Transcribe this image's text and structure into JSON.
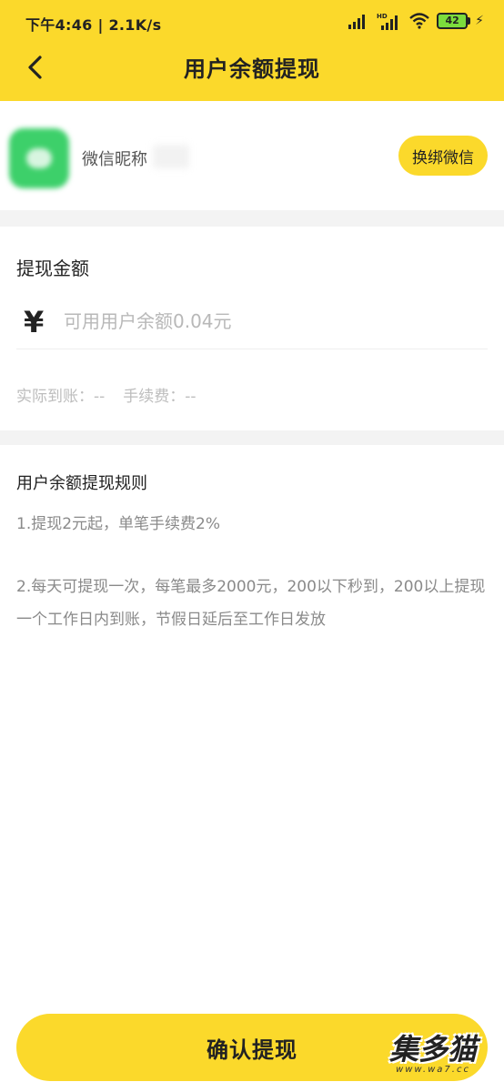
{
  "status_bar": {
    "time": "下午4:46 | 2.1K/s",
    "battery": "42",
    "icons": [
      "signal-icon",
      "hd-signal-icon",
      "wifi-icon",
      "battery-icon",
      "charging-icon"
    ]
  },
  "header": {
    "title": "用户余额提现",
    "back_icon": "chevron-left-icon",
    "color": "#fbd92b"
  },
  "account": {
    "nickname": "微信昵称",
    "rebind_label": "换绑微信",
    "avatar_icon": "wechat-avatar-icon"
  },
  "amount": {
    "label": "提现金额",
    "currency_symbol": "¥",
    "placeholder": "可用用户余额0.04元",
    "actual_received": "实际到账：--",
    "fee": "手续费：--"
  },
  "rules": {
    "title": "用户余额提现规则",
    "items": [
      "1.提现2元起，单笔手续费2%",
      "2.每天可提现一次，每笔最多2000元，200以下秒到，200以上提现一个工作日内到账，节假日延后至工作日发放"
    ]
  },
  "footer": {
    "confirm_label": "确认提现"
  },
  "watermark": {
    "text": "集多猫",
    "url": "www.wa7.cc"
  }
}
